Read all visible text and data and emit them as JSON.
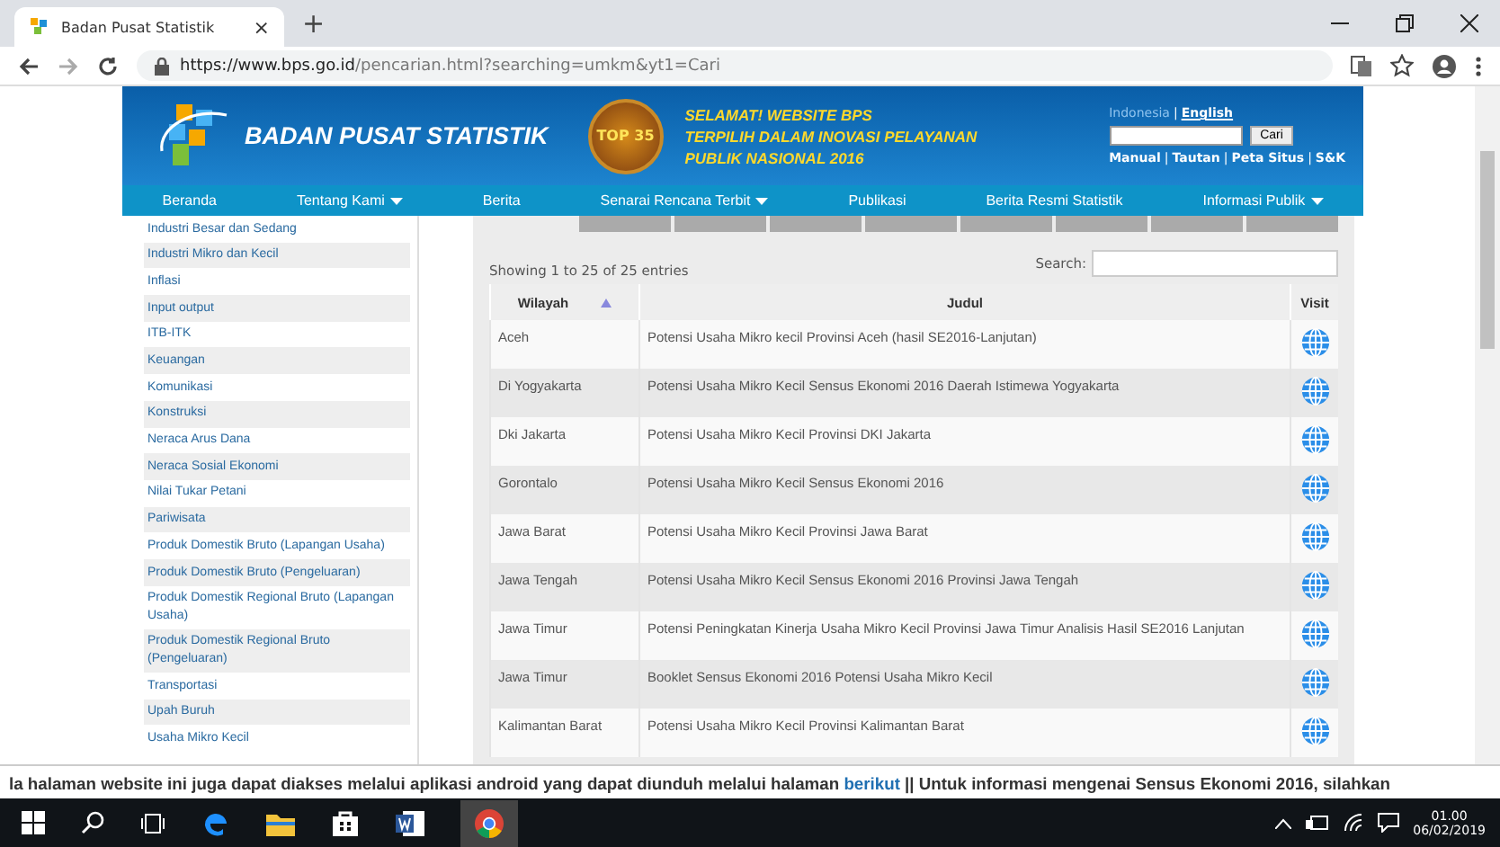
{
  "browser": {
    "tab_title": "Badan Pusat Statistik",
    "tab_close": "×",
    "new_tab": "+",
    "url_host": "https://www.bps.go.id",
    "url_path": "/pencarian.html?searching=umkm&yt1=Cari"
  },
  "header": {
    "site_name": "BADAN PUSAT STATISTIK",
    "badge": "TOP 35",
    "banner_lines": [
      "SELAMAT! WEBSITE BPS",
      "TERPILIH DALAM INOVASI PELAYANAN",
      "PUBLIK NASIONAL 2016"
    ],
    "languages": [
      {
        "label": "Indonesia",
        "selected": false
      },
      {
        "label": "English",
        "selected": true
      }
    ],
    "separator": "|",
    "search_button": "Cari",
    "links": [
      "Manual",
      "Tautan",
      "Peta Situs",
      "S&K"
    ]
  },
  "nav": [
    {
      "label": "Beranda",
      "dropdown": false
    },
    {
      "label": "Tentang Kami",
      "dropdown": true
    },
    {
      "label": "Berita",
      "dropdown": false
    },
    {
      "label": "Senarai Rencana Terbit",
      "dropdown": true
    },
    {
      "label": "Publikasi",
      "dropdown": false
    },
    {
      "label": "Berita Resmi Statistik",
      "dropdown": false
    },
    {
      "label": "Informasi Publik",
      "dropdown": true
    }
  ],
  "sidebar": {
    "items": [
      "Industri Besar dan Sedang",
      "Industri Mikro dan Kecil",
      "Inflasi",
      "Input output",
      "ITB-ITK",
      "Keuangan",
      "Komunikasi",
      "Konstruksi",
      "Neraca Arus Dana",
      "Neraca Sosial Ekonomi",
      "Nilai Tukar Petani",
      "Pariwisata",
      "Produk Domestik Bruto (Lapangan Usaha)",
      "Produk Domestik Bruto (Pengeluaran)",
      "Produk Domestik Regional Bruto (Lapangan Usaha)",
      "Produk Domestik Regional Bruto (Pengeluaran)",
      "Transportasi",
      "Upah Buruh",
      "Usaha Mikro Kecil"
    ]
  },
  "table": {
    "info": "Showing 1 to 25 of 25 entries",
    "search_label": "Search:",
    "columns": [
      "Wilayah",
      "Judul",
      "Visit"
    ],
    "rows": [
      {
        "wilayah": "Aceh",
        "judul": "Potensi Usaha Mikro kecil Provinsi Aceh (hasil SE2016-Lanjutan)"
      },
      {
        "wilayah": "Di Yogyakarta",
        "judul": "Potensi Usaha Mikro Kecil Sensus Ekonomi 2016 Daerah Istimewa Yogyakarta"
      },
      {
        "wilayah": "Dki Jakarta",
        "judul": "Potensi Usaha Mikro Kecil Provinsi DKI Jakarta"
      },
      {
        "wilayah": "Gorontalo",
        "judul": "Potensi Usaha Mikro Kecil Sensus Ekonomi 2016"
      },
      {
        "wilayah": "Jawa Barat",
        "judul": "Potensi Usaha Mikro Kecil Provinsi Jawa Barat"
      },
      {
        "wilayah": "Jawa Tengah",
        "judul": "Potensi Usaha Mikro Kecil Sensus Ekonomi 2016 Provinsi Jawa Tengah"
      },
      {
        "wilayah": "Jawa Timur",
        "judul": "Potensi Peningkatan Kinerja Usaha Mikro Kecil Provinsi Jawa Timur Analisis Hasil SE2016 Lanjutan"
      },
      {
        "wilayah": "Jawa Timur",
        "judul": "Booklet Sensus Ekonomi 2016 Potensi Usaha Mikro Kecil"
      },
      {
        "wilayah": "Kalimantan Barat",
        "judul": "Potensi Usaha Mikro Kecil Provinsi Kalimantan Barat"
      }
    ]
  },
  "ticker": {
    "before": "la halaman website ini juga dapat diakses melalui aplikasi android yang dapat diunduh melalui halaman",
    "link": "berikut",
    "after": "|| Untuk informasi mengenai Sensus Ekonomi 2016, silahkan"
  },
  "taskbar": {
    "time": "01.00",
    "date": "06/02/2019"
  }
}
